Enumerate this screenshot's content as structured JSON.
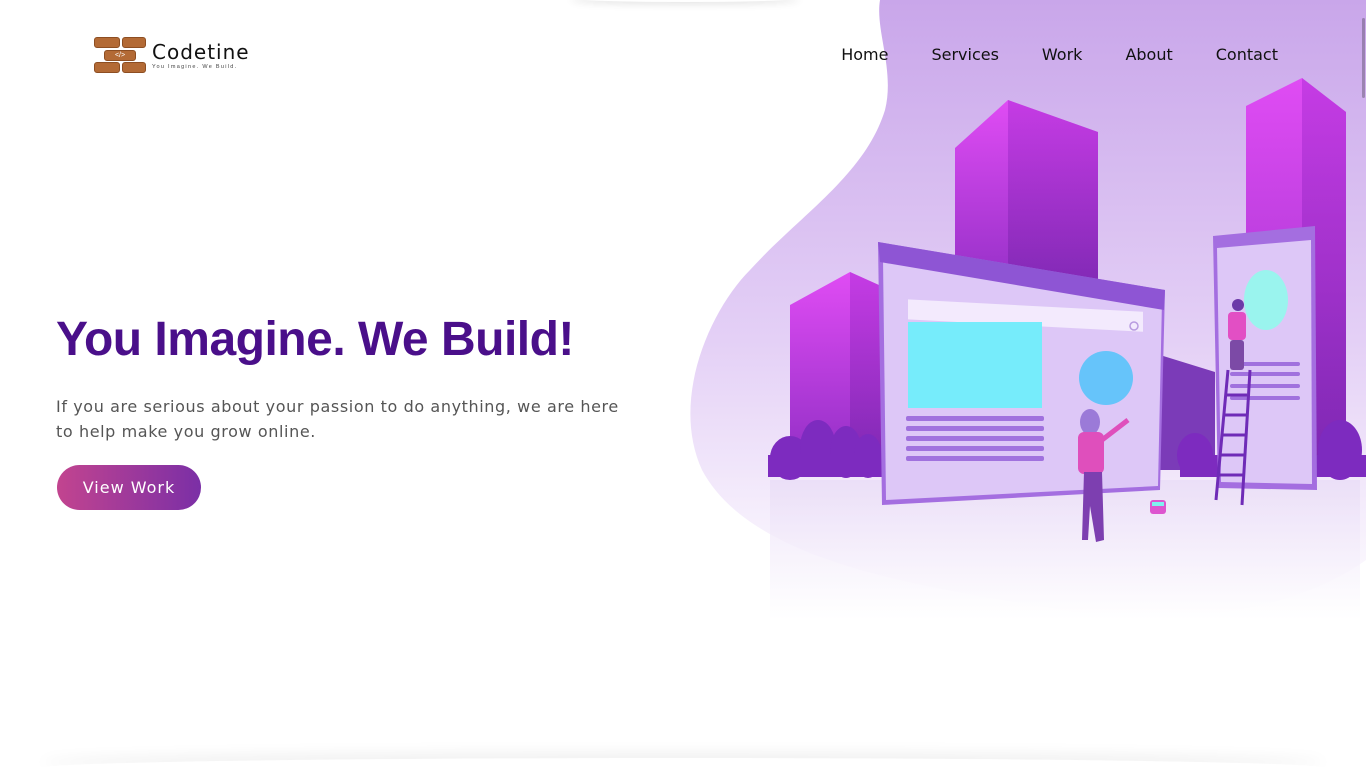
{
  "logo": {
    "name": "Codetine",
    "tagline": "You Imagine. We Build.",
    "mark_glyph": "</>",
    "icon": "brick-wall-code-icon",
    "brick_color": "#b36a35"
  },
  "nav": {
    "items": [
      {
        "label": "Home"
      },
      {
        "label": "Services"
      },
      {
        "label": "Work"
      },
      {
        "label": "About"
      },
      {
        "label": "Contact"
      }
    ]
  },
  "hero": {
    "title": "You Imagine. We Build!",
    "subtitle": "If you are serious about your passion to do anything, we are here to help make you grow online.",
    "cta_label": "View Work",
    "title_color": "#4a0f8a",
    "cta_gradient": [
      "#c2448f",
      "#7b2fa6"
    ],
    "illustration": "web-builders-illustration"
  }
}
